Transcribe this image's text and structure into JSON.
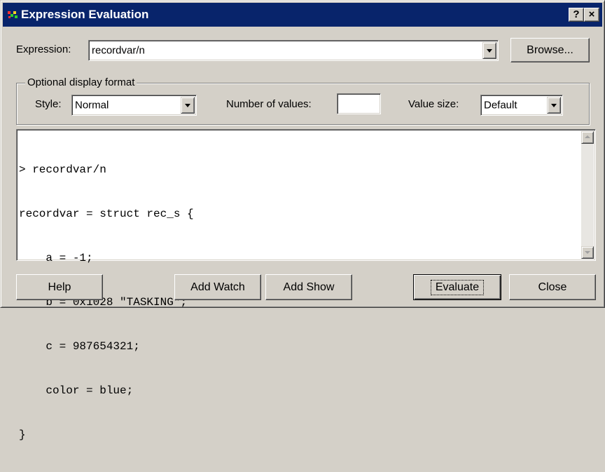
{
  "window": {
    "title": "Expression Evaluation",
    "help_button": "?",
    "close_button": "×",
    "icon": "multicolor-app-icon"
  },
  "expression": {
    "label": "Expression:",
    "value": "recordvar/n",
    "browse_label": "Browse..."
  },
  "display_format": {
    "group_label": "Optional display format",
    "style_label": "Style:",
    "style_value": "Normal",
    "num_values_label": "Number of values:",
    "num_values_value": "",
    "value_size_label": "Value size:",
    "value_size_value": "Default"
  },
  "output": {
    "lines": [
      "> recordvar/n",
      "recordvar = struct rec_s {",
      "    a = -1;",
      "    b = 0x1028 \"TASKING\";",
      "    c = 987654321;",
      "    color = blue;",
      "}"
    ]
  },
  "buttons": {
    "help": "Help",
    "add_watch": "Add Watch",
    "add_show": "Add Show",
    "evaluate": "Evaluate",
    "close": "Close"
  },
  "colors": {
    "titlebar": "#08246b",
    "face": "#d4d0c8"
  }
}
